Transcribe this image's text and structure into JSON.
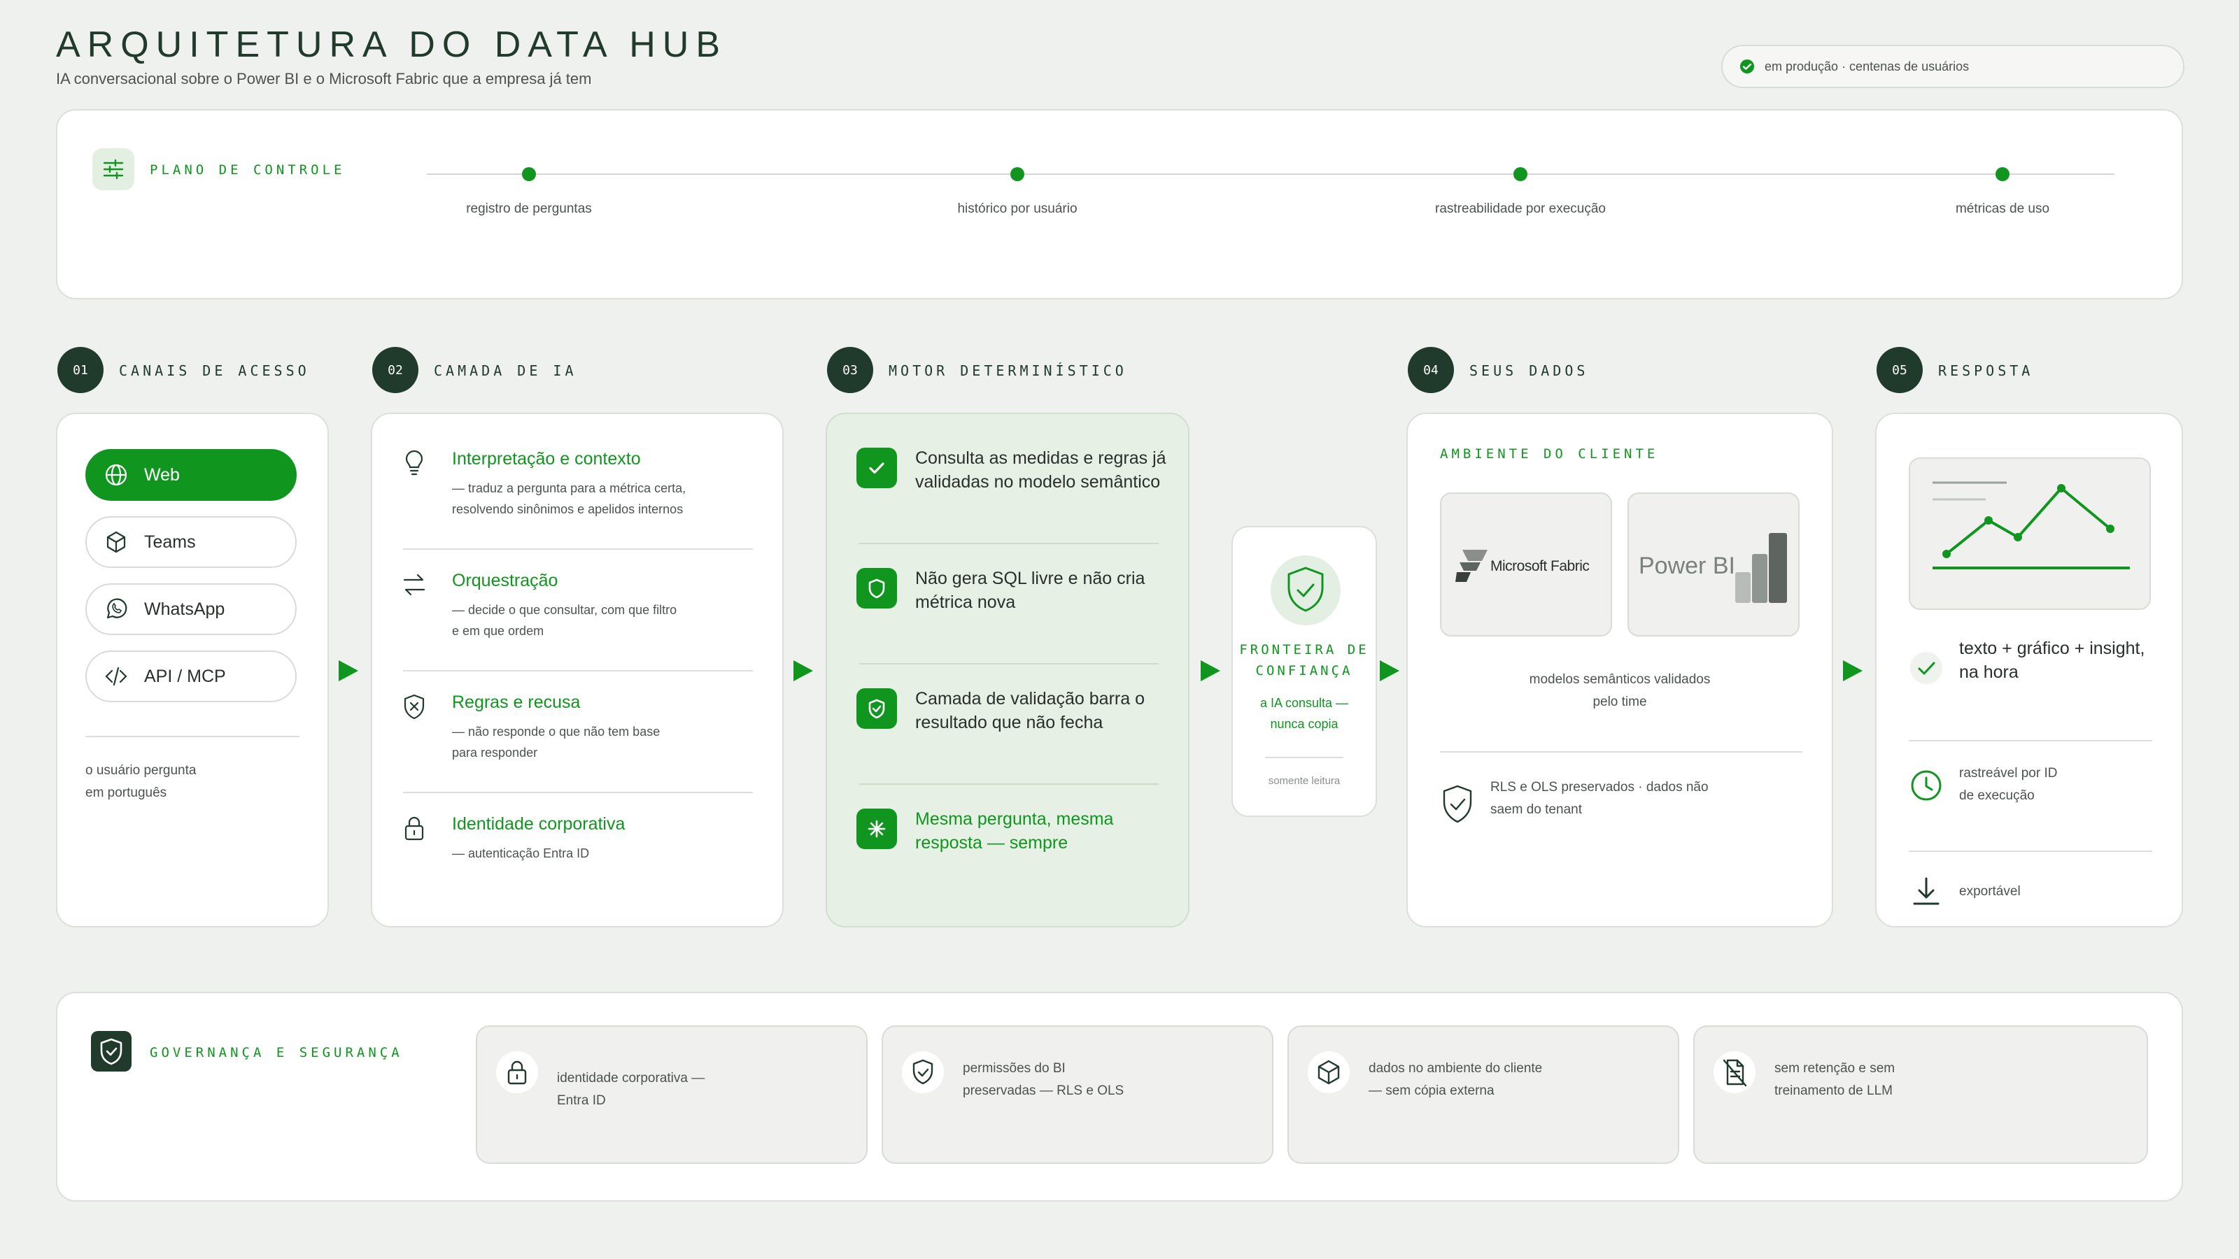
{
  "header": {
    "title": "ARQUITETURA DO DATA HUB",
    "subtitle": "IA conversacional sobre o Power BI e o Microsoft Fabric que a empresa já tem",
    "status": "em produção · centenas de usuários"
  },
  "control_plane": {
    "label": "PLANO DE CONTROLE",
    "items": [
      "registro de perguntas",
      "histórico por usuário",
      "rastreabilidade por execução",
      "métricas de uso"
    ]
  },
  "steps": [
    {
      "num": "01",
      "label": "CANAIS DE ACESSO"
    },
    {
      "num": "02",
      "label": "CAMADA DE IA"
    },
    {
      "num": "03",
      "label": "MOTOR DETERMINÍSTICO"
    },
    {
      "num": "04",
      "label": "SEUS DADOS"
    },
    {
      "num": "05",
      "label": "RESPOSTA"
    }
  ],
  "channels": {
    "items": [
      "Web",
      "Teams",
      "WhatsApp",
      "API / MCP"
    ],
    "note_line1": "o usuário pergunta",
    "note_line2": "em português"
  },
  "ai_layer": [
    {
      "title": "Interpretação e contexto",
      "desc_line1": "— traduz a pergunta para a métrica certa,",
      "desc_line2": "resolvendo sinônimos e apelidos internos"
    },
    {
      "title": "Orquestração",
      "desc_line1": "— decide o que consultar, com que filtro",
      "desc_line2": "e em que ordem"
    },
    {
      "title": "Regras e recusa",
      "desc_line1": "— não responde o que não tem base",
      "desc_line2": "para responder"
    },
    {
      "title": "Identidade corporativa",
      "desc_line1": "— autenticação Entra ID",
      "desc_line2": ""
    }
  ],
  "engine": [
    {
      "line1": "Consulta as medidas e regras já",
      "line2": "validadas no modelo semântico"
    },
    {
      "line1": "Não gera SQL livre e não cria",
      "line2": "métrica nova"
    },
    {
      "line1": "Camada de validação barra o",
      "line2": "resultado que não fecha"
    },
    {
      "line1": "Mesma pergunta, mesma",
      "line2": "resposta — sempre"
    }
  ],
  "trust": {
    "title_line1": "FRONTEIRA DE",
    "title_line2": "CONFIANÇA",
    "sub_line1": "a IA consulta —",
    "sub_line2": "nunca copia",
    "note": "somente leitura"
  },
  "data": {
    "env_label": "AMBIENTE DO CLIENTE",
    "fabric": "Microsoft Fabric",
    "powerbi": "Power BI",
    "models_line1": "modelos semânticos validados",
    "models_line2": "pelo time",
    "rls_line1": "RLS e OLS preservados · dados não",
    "rls_line2": "saem do tenant"
  },
  "response": {
    "main_line1": "texto + gráfico + insight,",
    "main_line2": "na hora",
    "trace_line1": "rastreável por ID",
    "trace_line2": "de execução",
    "export": "exportável"
  },
  "governance": {
    "label": "GOVERNANÇA E SEGURANÇA",
    "tiles": [
      {
        "line1": "identidade corporativa —",
        "line2": "Entra ID"
      },
      {
        "line1": "permissões do BI",
        "line2": "preservadas — RLS e OLS"
      },
      {
        "line1": "dados no ambiente do cliente",
        "line2": "— sem cópia externa"
      },
      {
        "line1": "sem retenção e sem",
        "line2": "treinamento de LLM"
      }
    ]
  },
  "colors": {
    "accent": "#10961f",
    "dark": "#203a2c",
    "background": "#eff1ee",
    "engine_bg": "#e6f0e4"
  }
}
